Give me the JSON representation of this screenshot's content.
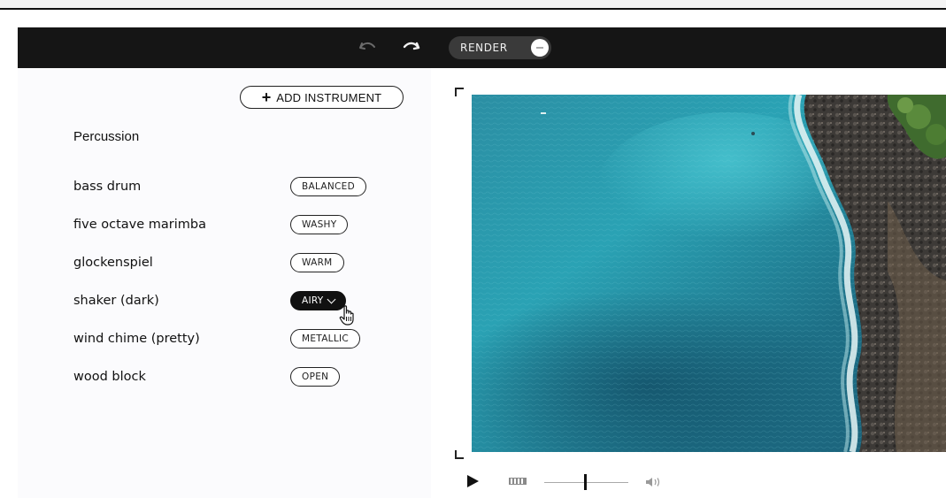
{
  "toolbar": {
    "undo_icon": "undo-icon",
    "redo_icon": "redo-icon",
    "render_label": "RENDER",
    "render_toggle_on": true
  },
  "instruments": {
    "add_label": "ADD INSTRUMENT",
    "section_title": "Percussion",
    "items": [
      {
        "name": "bass drum",
        "tone": "BALANCED"
      },
      {
        "name": "five octave marimba",
        "tone": "WASHY"
      },
      {
        "name": "glockenspiel",
        "tone": "WARM"
      },
      {
        "name": "shaker (dark)",
        "tone": "AIRY",
        "active": true
      },
      {
        "name": "wind chime (pretty)",
        "tone": "METALLIC"
      },
      {
        "name": "wood block",
        "tone": "OPEN"
      }
    ]
  },
  "player": {
    "video_subject": "aerial coastline footage",
    "play_icon": "play-icon",
    "frames_icon": "filmstrip-icon",
    "volume_icon": "volume-icon",
    "scrub_position": 0.48
  },
  "colors": {
    "toolbar_bg": "#151515",
    "active_pill": "#111111",
    "sea_deep": "#1f6f86",
    "sea_light": "#3fb3c2"
  }
}
